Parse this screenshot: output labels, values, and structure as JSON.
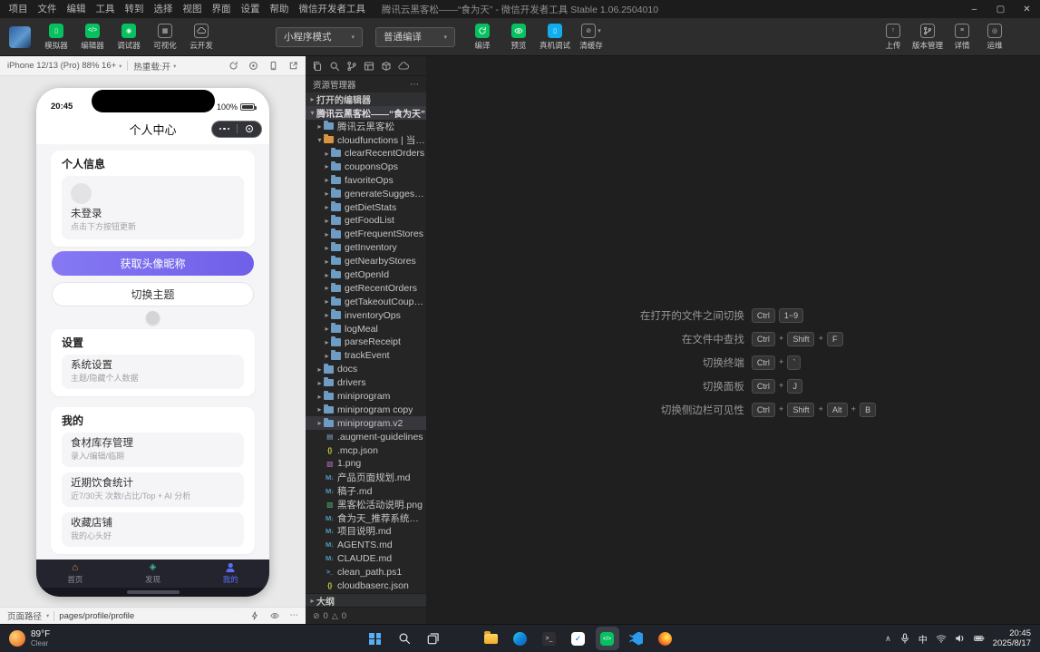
{
  "window": {
    "title": "腾讯云黑客松——“食为天” - 微信开发者工具 Stable 1.06.2504010",
    "menus": [
      "项目",
      "文件",
      "编辑",
      "工具",
      "转到",
      "选择",
      "视图",
      "界面",
      "设置",
      "帮助",
      "微信开发者工具"
    ]
  },
  "toolbar": {
    "left_tools": [
      {
        "name": "simulator-button",
        "label": "模拟器",
        "icon": "simulator-icon",
        "style": "green"
      },
      {
        "name": "editor-button",
        "label": "编辑器",
        "icon": "editor-icon",
        "style": "green"
      },
      {
        "name": "debugger-button",
        "label": "调试器",
        "icon": "debugger-icon",
        "style": "green"
      },
      {
        "name": "visual-button",
        "label": "可视化",
        "icon": "visual-icon",
        "style": "outline"
      },
      {
        "name": "clouddev-button",
        "label": "云开发",
        "icon": "cloud-icon",
        "style": "outline"
      }
    ],
    "mode_select": "小程序模式",
    "compile_select": "普通编译",
    "center_tools": [
      {
        "name": "compile-button",
        "label": "编译",
        "icon": "compile-icon",
        "style": "green"
      },
      {
        "name": "preview-button",
        "label": "预览",
        "icon": "preview-icon",
        "style": "green"
      },
      {
        "name": "real-device-debug-button",
        "label": "真机调试",
        "icon": "realdevice-icon",
        "style": "teal"
      },
      {
        "name": "clear-cache-button",
        "label": "清缓存",
        "icon": "clearcache-icon",
        "style": "outline",
        "caret": true
      }
    ],
    "right_tools": [
      {
        "name": "upload-button",
        "label": "上传",
        "icon": "upload-icon",
        "style": "outline"
      },
      {
        "name": "version-manage-button",
        "label": "版本管理",
        "icon": "version-icon",
        "style": "outline"
      },
      {
        "name": "details-button",
        "label": "详情",
        "icon": "detail-icon",
        "style": "outline"
      },
      {
        "name": "ops-button",
        "label": "运维",
        "icon": "ops-icon",
        "style": "outline"
      }
    ]
  },
  "simulator": {
    "device": "iPhone 12/13 (Pro) 88% 16+",
    "hot_reload": "热重载:开",
    "icons": [
      "refresh-icon",
      "record-icon",
      "rotate-icon",
      "popout-icon"
    ],
    "path_label": "页面路径",
    "path_value": "pages/profile/profile",
    "path_icons": [
      "lightning-icon",
      "eye-icon",
      "more-icon"
    ]
  },
  "phone": {
    "status_time": "20:45",
    "battery": "100%",
    "nav_title": "个人中心",
    "profile": {
      "section_title": "个人信息",
      "name": "未登录",
      "hint": "点击下方按钮更新"
    },
    "primary_button": "获取头像昵称",
    "secondary_button": "切换主题",
    "settings": {
      "section_title": "设置",
      "items": [
        {
          "title": "系统设置",
          "subtitle": "主题/隐藏个人数据"
        }
      ]
    },
    "mine": {
      "section_title": "我的",
      "items": [
        {
          "title": "食材库存管理",
          "subtitle": "录入/编辑/临期"
        },
        {
          "title": "近期饮食统计",
          "subtitle": "近7/30天 次数/占比/Top + AI 分析"
        },
        {
          "title": "收藏店铺",
          "subtitle": "我的心头好"
        }
      ]
    },
    "tabbar": [
      {
        "name": "home",
        "label": "首页",
        "icon": "home-icon"
      },
      {
        "name": "discover",
        "label": "发现",
        "icon": "discover-icon"
      },
      {
        "name": "mine",
        "label": "我的",
        "icon": "person-icon",
        "active": true
      }
    ]
  },
  "explorer": {
    "activity_icons": [
      "files-icon",
      "search-icon",
      "source-control-icon",
      "layout-icon",
      "package-icon",
      "cloud-icon"
    ],
    "title": "资源管理器",
    "tree": [
      {
        "kind": "section",
        "cls": "open",
        "chev": "r",
        "name": "打开的编辑器"
      },
      {
        "kind": "section",
        "cls": "project",
        "chev": "d",
        "name": "腾讯云黑客松——“食为天”"
      },
      {
        "kind": "folder",
        "depth": 1,
        "chev": "r",
        "color": "#6e9cc3",
        "name": "腾讯云黑客松"
      },
      {
        "kind": "folder",
        "depth": 1,
        "chev": "d",
        "color": "#d8953f",
        "name": "cloudfunctions | 当前..."
      },
      {
        "kind": "folder",
        "depth": 2,
        "chev": "r",
        "color": "#6e9cc3",
        "name": "clearRecentOrders"
      },
      {
        "kind": "folder",
        "depth": 2,
        "chev": "r",
        "color": "#6e9cc3",
        "name": "couponsOps"
      },
      {
        "kind": "folder",
        "depth": 2,
        "chev": "r",
        "color": "#6e9cc3",
        "name": "favoriteOps"
      },
      {
        "kind": "folder",
        "depth": 2,
        "chev": "r",
        "color": "#6e9cc3",
        "name": "generateSuggestions"
      },
      {
        "kind": "folder",
        "depth": 2,
        "chev": "r",
        "color": "#6e9cc3",
        "name": "getDietStats"
      },
      {
        "kind": "folder",
        "depth": 2,
        "chev": "r",
        "color": "#6e9cc3",
        "name": "getFoodList"
      },
      {
        "kind": "folder",
        "depth": 2,
        "chev": "r",
        "color": "#6e9cc3",
        "name": "getFrequentStores"
      },
      {
        "kind": "folder",
        "depth": 2,
        "chev": "r",
        "color": "#6e9cc3",
        "name": "getInventory"
      },
      {
        "kind": "folder",
        "depth": 2,
        "chev": "r",
        "color": "#6e9cc3",
        "name": "getNearbyStores"
      },
      {
        "kind": "folder",
        "depth": 2,
        "chev": "r",
        "color": "#6e9cc3",
        "name": "getOpenId"
      },
      {
        "kind": "folder",
        "depth": 2,
        "chev": "r",
        "color": "#6e9cc3",
        "name": "getRecentOrders"
      },
      {
        "kind": "folder",
        "depth": 2,
        "chev": "r",
        "color": "#6e9cc3",
        "name": "getTakeoutCoupons"
      },
      {
        "kind": "folder",
        "depth": 2,
        "chev": "r",
        "color": "#6e9cc3",
        "name": "inventoryOps"
      },
      {
        "kind": "folder",
        "depth": 2,
        "chev": "r",
        "color": "#6e9cc3",
        "name": "logMeal"
      },
      {
        "kind": "folder",
        "depth": 2,
        "chev": "r",
        "color": "#6e9cc3",
        "name": "parseReceipt"
      },
      {
        "kind": "folder",
        "depth": 2,
        "chev": "r",
        "color": "#6e9cc3",
        "name": "trackEvent"
      },
      {
        "kind": "folder",
        "depth": 1,
        "chev": "r",
        "color": "#6e9cc3",
        "name": "docs"
      },
      {
        "kind": "folder",
        "depth": 1,
        "chev": "r",
        "color": "#6e9cc3",
        "name": "drivers"
      },
      {
        "kind": "folder",
        "depth": 1,
        "chev": "r",
        "color": "#6e9cc3",
        "name": "miniprogram"
      },
      {
        "kind": "folder",
        "depth": 1,
        "chev": "r",
        "color": "#6e9cc3",
        "name": "miniprogram copy"
      },
      {
        "kind": "folder",
        "depth": 1,
        "chev": "r",
        "color": "#6e9cc3",
        "name": "miniprogram.v2",
        "selected": true
      },
      {
        "kind": "file",
        "depth": 1,
        "icon": "doc",
        "color": "#8ab4dd",
        "name": ".augment-guidelines"
      },
      {
        "kind": "file",
        "depth": 1,
        "icon": "json",
        "color": "#cbcb41",
        "name": ".mcp.json"
      },
      {
        "kind": "file",
        "depth": 1,
        "icon": "image",
        "color": "#c678c6",
        "name": "1.png"
      },
      {
        "kind": "file",
        "depth": 1,
        "icon": "md",
        "color": "#519aba",
        "name": "产品页面规划.md"
      },
      {
        "kind": "file",
        "depth": 1,
        "icon": "md",
        "color": "#519aba",
        "name": "稿子.md"
      },
      {
        "kind": "file",
        "depth": 1,
        "icon": "image",
        "color": "#5bb97a",
        "name": "黑客松活动说明.png"
      },
      {
        "kind": "file",
        "depth": 1,
        "icon": "md",
        "color": "#519aba",
        "name": "食为天_推荐系统计划..."
      },
      {
        "kind": "file",
        "depth": 1,
        "icon": "md",
        "color": "#519aba",
        "name": "项目说明.md"
      },
      {
        "kind": "file",
        "depth": 1,
        "icon": "md",
        "color": "#519aba",
        "name": "AGENTS.md"
      },
      {
        "kind": "file",
        "depth": 1,
        "icon": "md",
        "color": "#519aba",
        "name": "CLAUDE.md"
      },
      {
        "kind": "file",
        "depth": 1,
        "icon": "ps",
        "color": "#5f9fd8",
        "name": "clean_path.ps1"
      },
      {
        "kind": "file",
        "depth": 1,
        "icon": "json",
        "color": "#cbcb41",
        "name": "cloudbaserc.json"
      }
    ],
    "outline_label": "大纲",
    "problems": {
      "errors": "0",
      "warnings": "0"
    }
  },
  "editor": {
    "shortcuts": [
      {
        "label": "在打开的文件之间切换",
        "keys": [
          "Ctrl",
          "1~9"
        ],
        "sep": ""
      },
      {
        "label": "在文件中查找",
        "keys": [
          "Ctrl",
          "Shift",
          "F"
        ],
        "sep": "+"
      },
      {
        "label": "切换终端",
        "keys": [
          "Ctrl",
          "`"
        ],
        "sep": "+"
      },
      {
        "label": "切换面板",
        "keys": [
          "Ctrl",
          "J"
        ],
        "sep": "+"
      },
      {
        "label": "切换侧边栏可见性",
        "keys": [
          "Ctrl",
          "Shift",
          "Alt",
          "B"
        ],
        "sep": "+"
      }
    ]
  },
  "taskbar": {
    "weather": {
      "temp": "89°F",
      "desc": "Clear"
    },
    "apps": [
      {
        "name": "start-button",
        "type": "start"
      },
      {
        "name": "search-button",
        "type": "search"
      },
      {
        "name": "task-view-button",
        "type": "taskview"
      },
      {
        "name": "chrome-icon",
        "type": "ch rome_placeholder"
      },
      {
        "name": "file-explorer-icon",
        "type": "folder"
      },
      {
        "name": "edge-icon",
        "type": "edge"
      },
      {
        "name": "terminal-icon",
        "type": "terminal"
      },
      {
        "name": "todo-icon",
        "type": "todo"
      },
      {
        "name": "wechat-devtools-icon",
        "type": "wxdev",
        "active": true
      },
      {
        "name": "vscode-icon",
        "type": "vscode"
      },
      {
        "name": "firefox-icon",
        "type": "firefox"
      }
    ],
    "tray_icons": [
      "chevron-up-icon",
      "mic-icon",
      "ime",
      "wifi-icon",
      "volume-icon",
      "battery-icon"
    ],
    "ime": "中",
    "time": "20:45",
    "date": "2025/8/17"
  },
  "colors": {
    "wechat_green": "#07c160",
    "primary_button": "#7b6cf0",
    "tab_active": "#5b6ef5",
    "folder_default": "#6e9cc3",
    "folder_cloudfunctions": "#d8953f"
  }
}
